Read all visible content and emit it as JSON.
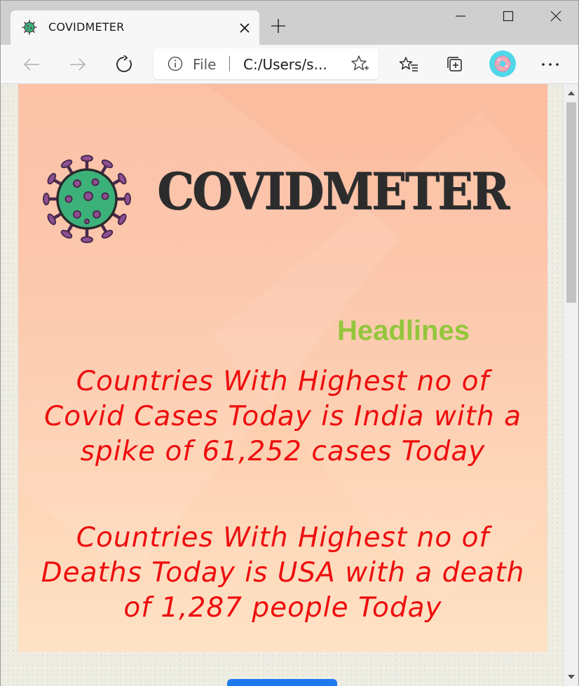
{
  "browser": {
    "tab": {
      "title": "COVIDMETER",
      "favicon": "virus-icon"
    },
    "window_controls": [
      "minimize-icon",
      "maximize-icon",
      "close-icon"
    ],
    "toolbar": {
      "back": "back-arrow-icon",
      "forward": "forward-arrow-icon",
      "refresh": "refresh-icon",
      "favorites": "favorites-icon",
      "collections": "collections-icon",
      "menu": "more-icon"
    },
    "address": {
      "scheme_label": "File",
      "url": "C:/Users/s..."
    }
  },
  "page": {
    "logo_text": "COVIDMETER",
    "section_title": "Headlines",
    "headline_1": "Countries With Highest no of Covid Cases Today is India with a spike of 61,252 cases Today",
    "headline_2": "Countries With Highest no of Deaths Today is USA with a death of 1,287 people Today"
  },
  "colors": {
    "headline_text": "#ee0e0e",
    "section_title": "#93c63c",
    "logo_text": "#2c2c2c",
    "virus_body": "#3cb27a",
    "virus_spikes": "#7a3f7f",
    "button": "#1e79ef"
  }
}
